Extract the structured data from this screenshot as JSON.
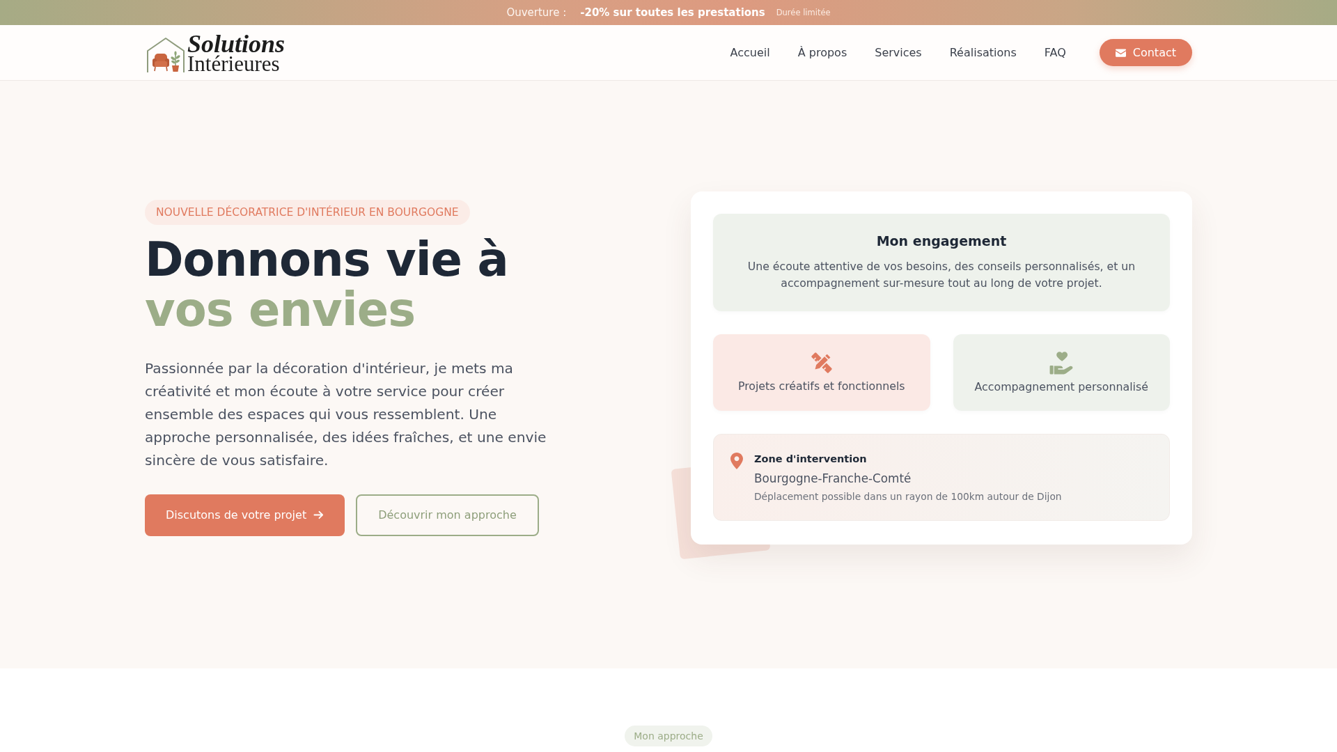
{
  "promo_bar": {
    "label": "Ouverture :",
    "offer": "-20% sur toutes les prestations",
    "note": "Durée limitée"
  },
  "header": {
    "logo": {
      "line_1": "Solutions",
      "line_2": "Intérieures"
    },
    "nav": [
      {
        "label": "Accueil",
        "selected": false
      },
      {
        "label": "À propos",
        "selected": false
      },
      {
        "label": "Services",
        "selected": false
      },
      {
        "label": "Réalisations",
        "selected": false
      },
      {
        "label": "FAQ",
        "selected": false
      }
    ],
    "contact_button": "Contact"
  },
  "hero": {
    "tagline": "NOUVELLE DÉCORATRICE D'INTÉRIEUR EN BOURGOGNE",
    "title_line_1": "Donnons vie à",
    "title_line_2": "vos envies",
    "intro": "Passionnée par la décoration d'intérieur, je mets ma créativité et mon écoute à votre service pour créer ensemble des espaces qui vous ressemblent. Une approche personnalisée, des idées fraîches, et une envie sincère de vous satisfaire.",
    "buttons": [
      {
        "label": "Discutons de votre projet",
        "kind": "primary"
      },
      {
        "label": "Découvrir mon approche",
        "kind": "outline"
      }
    ]
  },
  "info_card": {
    "commitment": {
      "title": "Mon engagement",
      "text": "Une écoute attentive de vos besoins, des conseils personnalisés, et un accompagnement sur-mesure tout au long de votre projet."
    },
    "features": [
      {
        "label": "Projets créatifs et fonctionnels",
        "kind": "tools"
      },
      {
        "label": "Accompagnement personnalisé",
        "kind": "care"
      }
    ],
    "zone": {
      "title": "Zone d'intervention",
      "region": "Bourgogne-Franche-Comté",
      "note": "Déplacement possible dans un rayon de 100km autour de Dijon"
    }
  },
  "next_section": {
    "tagline": "Mon approche"
  }
}
